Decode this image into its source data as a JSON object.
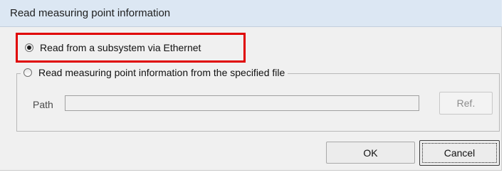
{
  "window": {
    "title": "Read measuring point information"
  },
  "options": {
    "subsystem": {
      "label": "Read from a subsystem via Ethernet",
      "selected": true
    },
    "file": {
      "label": "Read measuring point information from the specified file",
      "selected": false
    }
  },
  "path": {
    "label": "Path",
    "value": "",
    "enabled": false
  },
  "buttons": {
    "ref_label": "Ref.",
    "ok_label": "OK",
    "cancel_label": "Cancel"
  },
  "colors": {
    "highlight": "#e00000",
    "titlebar": "#dce7f3",
    "dialog_bg": "#f0f0f0"
  }
}
